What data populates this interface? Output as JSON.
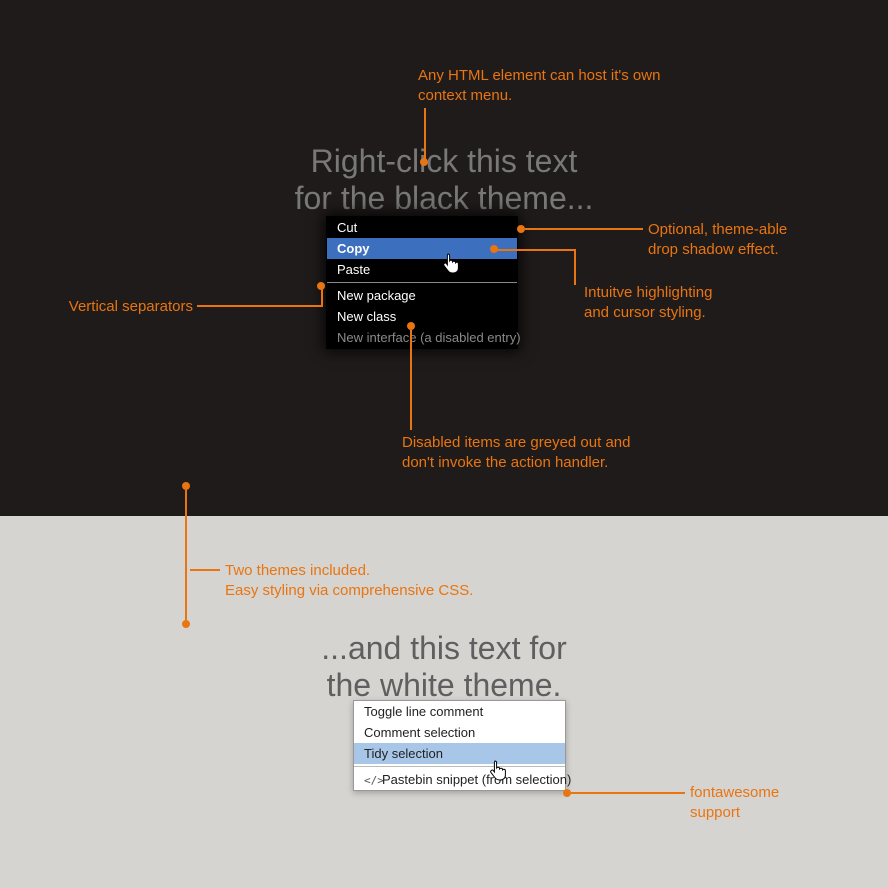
{
  "headline_dark_line1": "Right-click this text",
  "headline_dark_line2": "for the black theme...",
  "headline_light_line1": "...and this text for",
  "headline_light_line2": "the white theme.",
  "anno_html_host_1": "Any HTML element can host it's own",
  "anno_html_host_2": "context menu.",
  "anno_shadow_1": "Optional, theme-able",
  "anno_shadow_2": "drop shadow effect.",
  "anno_highlight_1": "Intuitve highlighting",
  "anno_highlight_2": "and cursor styling.",
  "anno_vsep": "Vertical separators",
  "anno_disabled_1": "Disabled items are greyed out and",
  "anno_disabled_2": "don't invoke the action handler.",
  "anno_themes_1": "Two themes included.",
  "anno_themes_2": "Easy styling via comprehensive CSS.",
  "anno_fa_1": "fontawesome",
  "anno_fa_2": "support",
  "menu_black": {
    "cut": "Cut",
    "copy": "Copy",
    "paste": "Paste",
    "new_package": "New package",
    "new_class": "New class",
    "new_interface": "New interface (a disabled entry)"
  },
  "menu_white": {
    "toggle": "Toggle line comment",
    "comment": "Comment selection",
    "tidy": "Tidy selection",
    "pastebin": "Pastebin snippet (from selection)"
  },
  "icon_code_glyph": "</>"
}
